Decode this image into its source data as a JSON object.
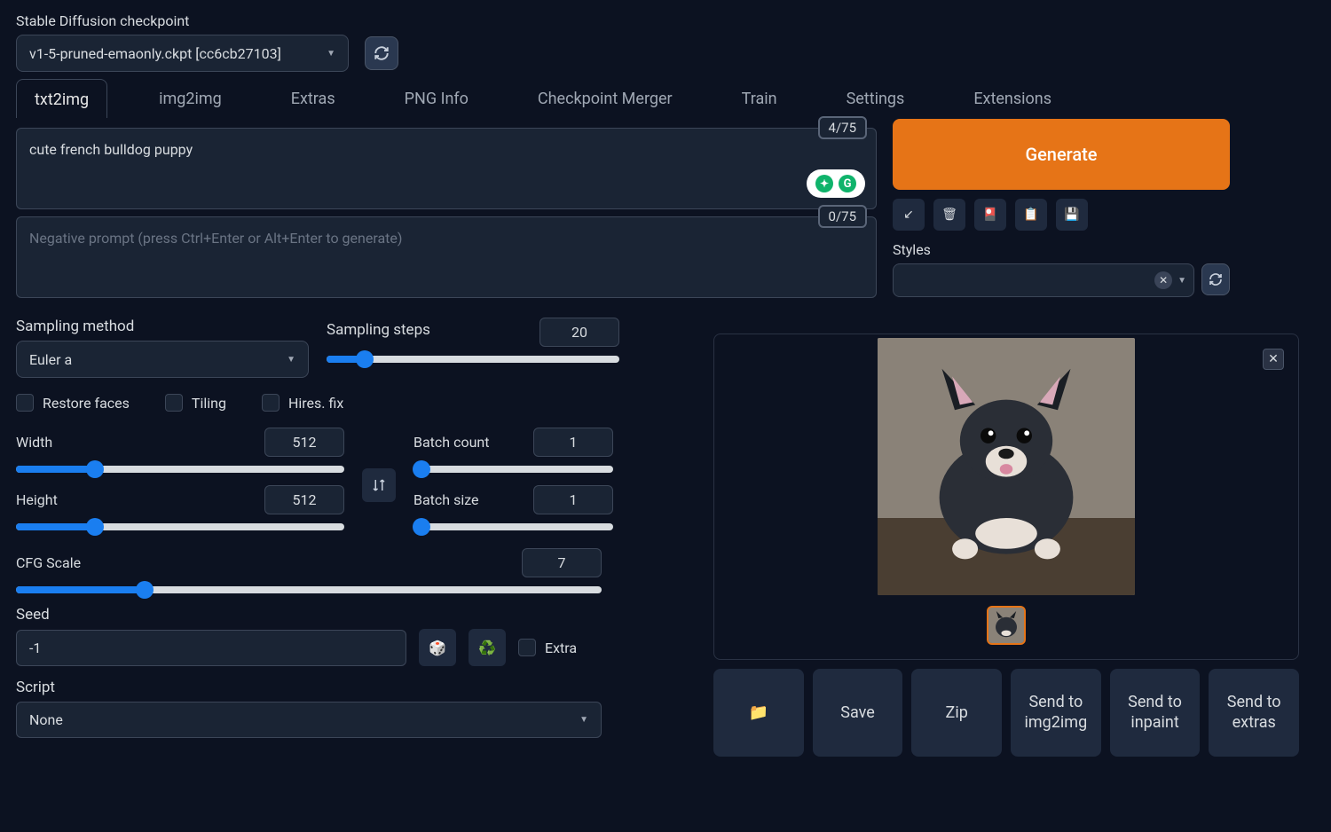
{
  "checkpoint": {
    "label": "Stable Diffusion checkpoint",
    "value": "v1-5-pruned-emaonly.ckpt [cc6cb27103]"
  },
  "tabs": [
    "txt2img",
    "img2img",
    "Extras",
    "PNG Info",
    "Checkpoint Merger",
    "Train",
    "Settings",
    "Extensions"
  ],
  "active_tab": "txt2img",
  "prompt": {
    "value": "cute french bulldog puppy",
    "counter": "4/75"
  },
  "neg_prompt": {
    "placeholder": "Negative prompt (press Ctrl+Enter or Alt+Enter to generate)",
    "counter": "0/75"
  },
  "generate_label": "Generate",
  "styles_label": "Styles",
  "sampling_method": {
    "label": "Sampling method",
    "value": "Euler a"
  },
  "sampling_steps": {
    "label": "Sampling steps",
    "value": "20",
    "pct": 13
  },
  "checks": {
    "restore": "Restore faces",
    "tiling": "Tiling",
    "hires": "Hires. fix"
  },
  "width": {
    "label": "Width",
    "value": "512",
    "pct": 24
  },
  "height": {
    "label": "Height",
    "value": "512",
    "pct": 24
  },
  "batch_count": {
    "label": "Batch count",
    "value": "1",
    "pct": 2
  },
  "batch_size": {
    "label": "Batch size",
    "value": "1",
    "pct": 2
  },
  "cfg": {
    "label": "CFG Scale",
    "value": "7",
    "pct": 22
  },
  "seed": {
    "label": "Seed",
    "value": "-1",
    "extra": "Extra"
  },
  "script": {
    "label": "Script",
    "value": "None"
  },
  "output_buttons": {
    "save": "Save",
    "zip": "Zip",
    "send_img2img": "Send to img2img",
    "send_inpaint": "Send to inpaint",
    "send_extras": "Send to extras"
  }
}
